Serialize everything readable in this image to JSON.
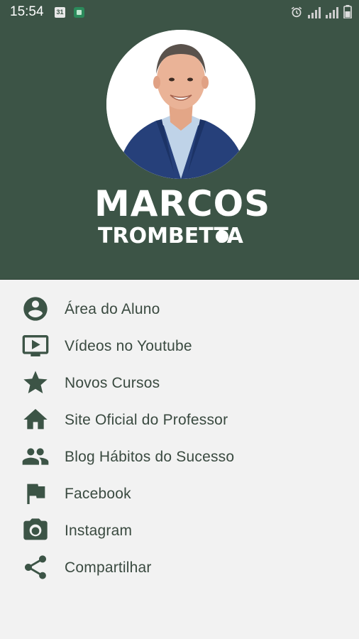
{
  "status_bar": {
    "time": "15:54",
    "calendar_day": "31"
  },
  "header": {
    "logo_name": "MARCOS",
    "logo_surname": "TROMBETTA",
    "background_color": "#3c5446"
  },
  "menu": {
    "items": [
      {
        "label": "Área do Aluno",
        "icon": "account-circle-icon"
      },
      {
        "label": "Vídeos no Youtube",
        "icon": "tv-play-icon"
      },
      {
        "label": "Novos Cursos",
        "icon": "star-icon"
      },
      {
        "label": "Site Oficial do Professor",
        "icon": "home-icon"
      },
      {
        "label": "Blog Hábitos do Sucesso",
        "icon": "people-icon"
      },
      {
        "label": "Facebook",
        "icon": "flag-icon"
      },
      {
        "label": "Instagram",
        "icon": "camera-icon"
      },
      {
        "label": "Compartilhar",
        "icon": "share-icon"
      }
    ]
  },
  "colors": {
    "icon": "#3c5446",
    "text": "#3a4a40",
    "drawer_background": "#f2f2f2"
  }
}
